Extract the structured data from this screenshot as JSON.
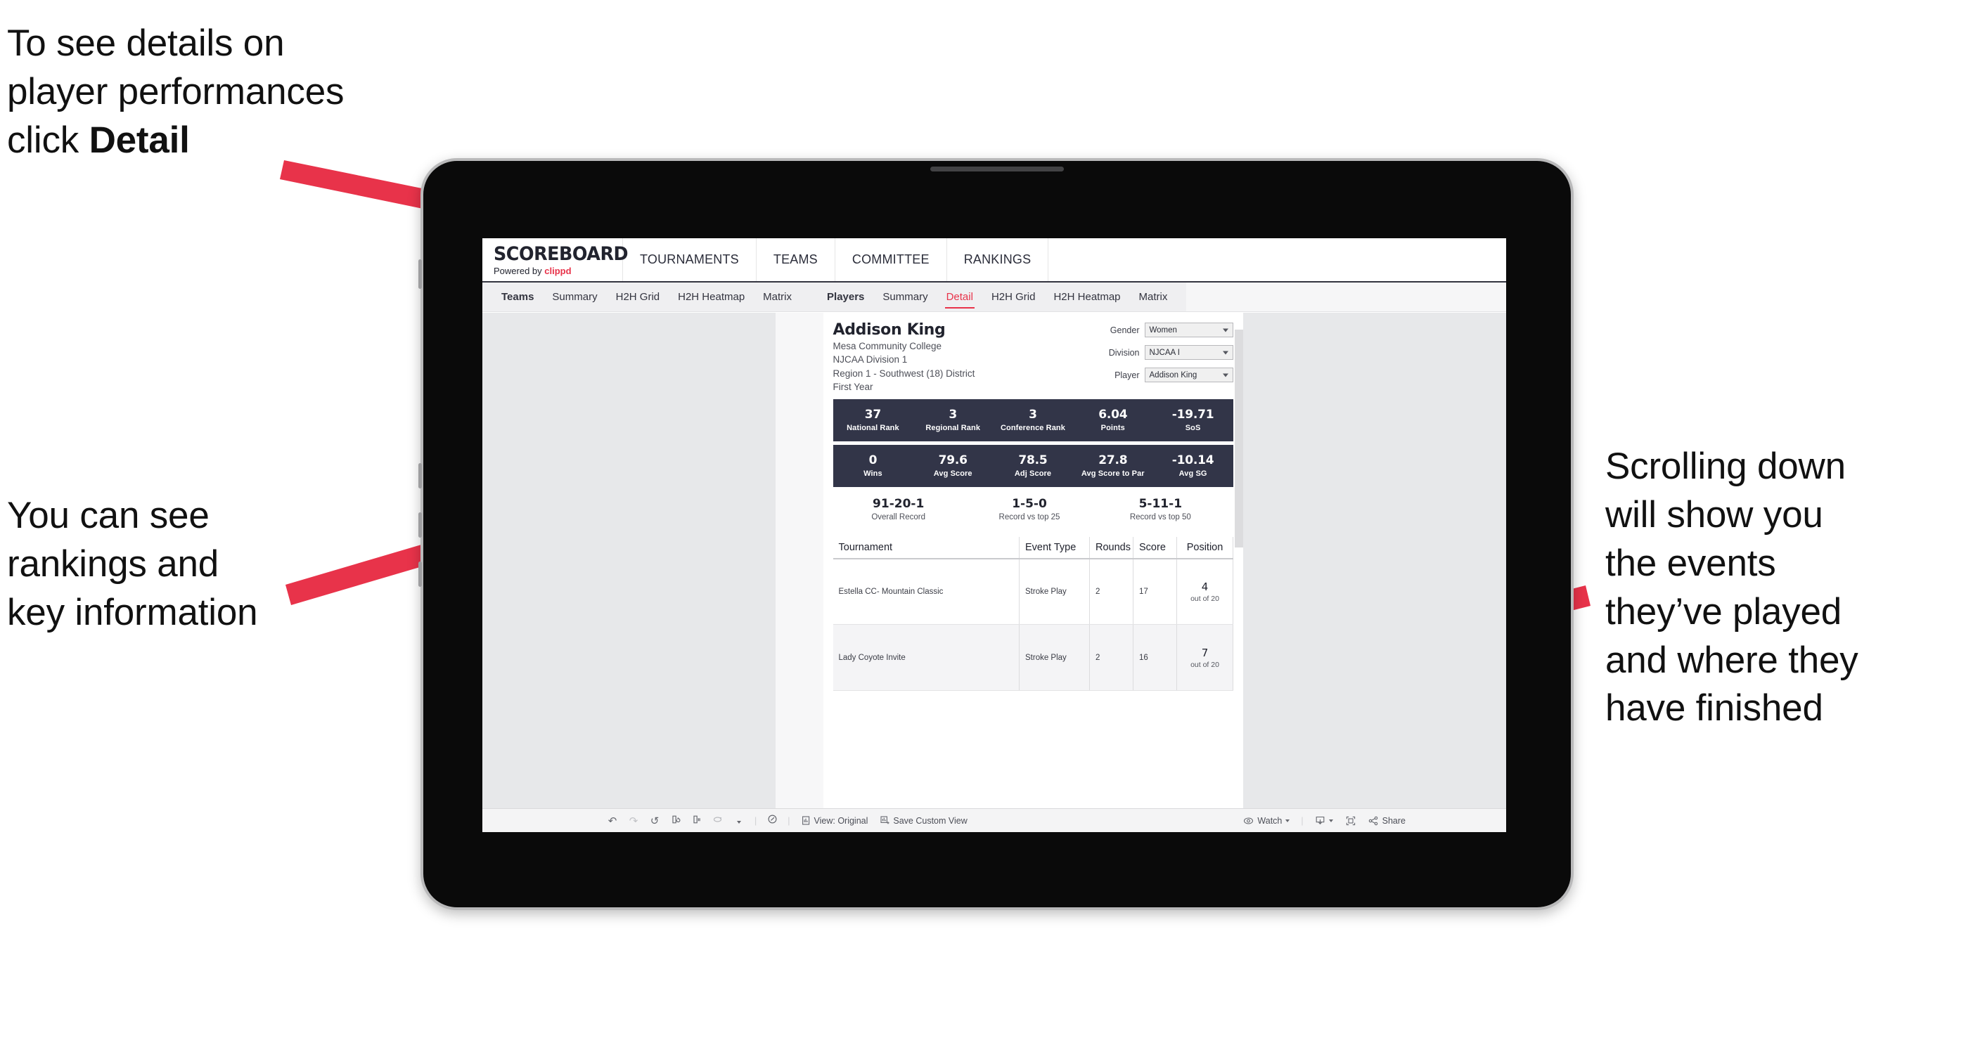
{
  "annotations": {
    "detail": "To see details on\nplayer performances\nclick ",
    "detail_bold": "Detail",
    "rankings": "You can see\nrankings and\nkey information",
    "scrolling": "Scrolling down\nwill show you\nthe events\nthey’ve played\nand where they\nhave finished"
  },
  "accent": "#e8334a",
  "dark": "#323548",
  "app": {
    "logo": {
      "title": "SCOREBOARD",
      "powered_prefix": "Powered by ",
      "brand": "clippd"
    },
    "topnav": [
      "TOURNAMENTS",
      "TEAMS",
      "COMMITTEE",
      "RANKINGS"
    ],
    "subnav": {
      "teams_group": [
        "Teams",
        "Summary",
        "H2H Grid",
        "H2H Heatmap",
        "Matrix"
      ],
      "players_group": [
        "Players",
        "Summary",
        "Detail",
        "H2H Grid",
        "H2H Heatmap",
        "Matrix"
      ],
      "active": "Detail"
    }
  },
  "player": {
    "name": "Addison King",
    "school": "Mesa Community College",
    "division": "NJCAA Division 1",
    "region": "Region 1 - Southwest (18) District",
    "year": "First Year"
  },
  "filters": [
    {
      "label": "Gender",
      "value": "Women"
    },
    {
      "label": "Division",
      "value": "NJCAA I"
    },
    {
      "label": "Player",
      "value": "Addison King"
    }
  ],
  "stats_row1": [
    {
      "value": "37",
      "label": "National Rank"
    },
    {
      "value": "3",
      "label": "Regional Rank"
    },
    {
      "value": "3",
      "label": "Conference Rank"
    },
    {
      "value": "6.04",
      "label": "Points"
    },
    {
      "value": "-19.71",
      "label": "SoS"
    }
  ],
  "stats_row2": [
    {
      "value": "0",
      "label": "Wins"
    },
    {
      "value": "79.6",
      "label": "Avg Score"
    },
    {
      "value": "78.5",
      "label": "Adj Score"
    },
    {
      "value": "27.8",
      "label": "Avg Score to Par"
    },
    {
      "value": "-10.14",
      "label": "Avg SG"
    }
  ],
  "records": [
    {
      "value": "91-20-1",
      "label": "Overall Record"
    },
    {
      "value": "1-5-0",
      "label": "Record vs top 25"
    },
    {
      "value": "5-11-1",
      "label": "Record vs top 50"
    }
  ],
  "table": {
    "headers": [
      "Tournament",
      "Event Type",
      "Rounds",
      "Score",
      "Position"
    ],
    "rows": [
      {
        "tournament": "Estella CC- Mountain Classic",
        "event_type": "Stroke Play",
        "rounds": "2",
        "score": "17",
        "position": "4",
        "position_sub": "out of 20"
      },
      {
        "tournament": "Lady Coyote Invite",
        "event_type": "Stroke Play",
        "rounds": "2",
        "score": "16",
        "position": "7",
        "position_sub": "out of 20"
      }
    ]
  },
  "toolbar": {
    "view_label": "View: Original",
    "save_label": "Save Custom View",
    "watch_label": "Watch",
    "share_label": "Share"
  }
}
